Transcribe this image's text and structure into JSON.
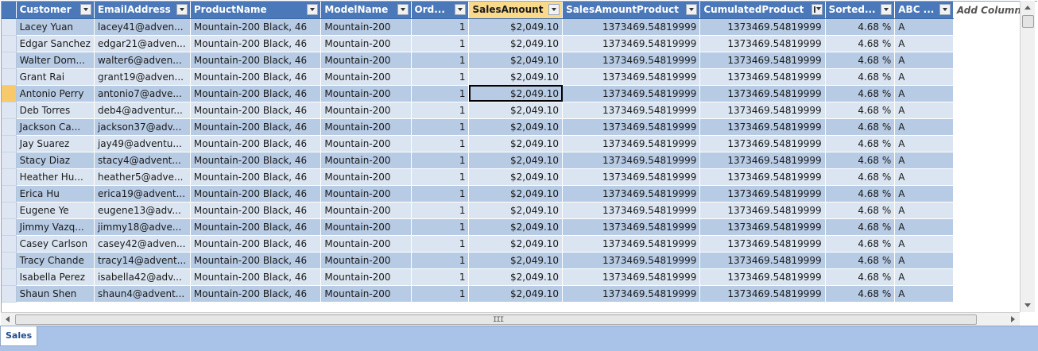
{
  "columns": [
    {
      "label": "Customer",
      "align": "left"
    },
    {
      "label": "EmailAddress",
      "align": "left"
    },
    {
      "label": "ProductName",
      "align": "left"
    },
    {
      "label": "ModelName",
      "align": "left"
    },
    {
      "label": "Ord...",
      "align": "right"
    },
    {
      "label": "SalesAmount",
      "align": "right",
      "selected": true
    },
    {
      "label": "SalesAmountProduct",
      "align": "right"
    },
    {
      "label": "CumulatedProduct",
      "align": "right",
      "filter_applied": true
    },
    {
      "label": "Sorted...",
      "align": "right"
    },
    {
      "label": "ABC ...",
      "align": "left"
    }
  ],
  "add_column_label": "Add Column",
  "rows": [
    [
      "Lacey Yuan",
      "lacey41@adven...",
      "Mountain-200 Black, 46",
      "Mountain-200",
      "1",
      "$2,049.10",
      "1373469.54819999",
      "1373469.54819999",
      "4.68 %",
      "A"
    ],
    [
      "Edgar Sanchez",
      "edgar21@adven...",
      "Mountain-200 Black, 46",
      "Mountain-200",
      "1",
      "$2,049.10",
      "1373469.54819999",
      "1373469.54819999",
      "4.68 %",
      "A"
    ],
    [
      "Walter Dom...",
      "walter6@adven...",
      "Mountain-200 Black, 46",
      "Mountain-200",
      "1",
      "$2,049.10",
      "1373469.54819999",
      "1373469.54819999",
      "4.68 %",
      "A"
    ],
    [
      "Grant Rai",
      "grant19@adven...",
      "Mountain-200 Black, 46",
      "Mountain-200",
      "1",
      "$2,049.10",
      "1373469.54819999",
      "1373469.54819999",
      "4.68 %",
      "A"
    ],
    [
      "Antonio Perry",
      "antonio7@adve...",
      "Mountain-200 Black, 46",
      "Mountain-200",
      "1",
      "$2,049.10",
      "1373469.54819999",
      "1373469.54819999",
      "4.68 %",
      "A"
    ],
    [
      "Deb Torres",
      "deb4@adventur...",
      "Mountain-200 Black, 46",
      "Mountain-200",
      "1",
      "$2,049.10",
      "1373469.54819999",
      "1373469.54819999",
      "4.68 %",
      "A"
    ],
    [
      "Jackson Ca...",
      "jackson37@adv...",
      "Mountain-200 Black, 46",
      "Mountain-200",
      "1",
      "$2,049.10",
      "1373469.54819999",
      "1373469.54819999",
      "4.68 %",
      "A"
    ],
    [
      "Jay Suarez",
      "jay49@adventu...",
      "Mountain-200 Black, 46",
      "Mountain-200",
      "1",
      "$2,049.10",
      "1373469.54819999",
      "1373469.54819999",
      "4.68 %",
      "A"
    ],
    [
      "Stacy Diaz",
      "stacy4@advent...",
      "Mountain-200 Black, 46",
      "Mountain-200",
      "1",
      "$2,049.10",
      "1373469.54819999",
      "1373469.54819999",
      "4.68 %",
      "A"
    ],
    [
      "Heather Hu...",
      "heather5@adve...",
      "Mountain-200 Black, 46",
      "Mountain-200",
      "1",
      "$2,049.10",
      "1373469.54819999",
      "1373469.54819999",
      "4.68 %",
      "A"
    ],
    [
      "Erica Hu",
      "erica19@advent...",
      "Mountain-200 Black, 46",
      "Mountain-200",
      "1",
      "$2,049.10",
      "1373469.54819999",
      "1373469.54819999",
      "4.68 %",
      "A"
    ],
    [
      "Eugene Ye",
      "eugene13@adv...",
      "Mountain-200 Black, 46",
      "Mountain-200",
      "1",
      "$2,049.10",
      "1373469.54819999",
      "1373469.54819999",
      "4.68 %",
      "A"
    ],
    [
      "Jimmy Vazq...",
      "jimmy18@adve...",
      "Mountain-200 Black, 46",
      "Mountain-200",
      "1",
      "$2,049.10",
      "1373469.54819999",
      "1373469.54819999",
      "4.68 %",
      "A"
    ],
    [
      "Casey Carlson",
      "casey42@adven...",
      "Mountain-200 Black, 46",
      "Mountain-200",
      "1",
      "$2,049.10",
      "1373469.54819999",
      "1373469.54819999",
      "4.68 %",
      "A"
    ],
    [
      "Tracy Chande",
      "tracy14@advent...",
      "Mountain-200 Black, 46",
      "Mountain-200",
      "1",
      "$2,049.10",
      "1373469.54819999",
      "1373469.54819999",
      "4.68 %",
      "A"
    ],
    [
      "Isabella Perez",
      "isabella42@adv...",
      "Mountain-200 Black, 46",
      "Mountain-200",
      "1",
      "$2,049.10",
      "1373469.54819999",
      "1373469.54819999",
      "4.68 %",
      "A"
    ],
    [
      "Shaun Shen",
      "shaun4@advent...",
      "Mountain-200 Black, 46",
      "Mountain-200",
      "1",
      "$2,049.10",
      "1373469.54819999",
      "1373469.54819999",
      "4.68 %",
      "A"
    ]
  ],
  "current_row_index": 4,
  "active_cell": {
    "row": 4,
    "column": "SalesAmount"
  },
  "sheet_tabs": [
    {
      "label": "Sales",
      "active": true
    }
  ],
  "scrollbars": {
    "horizontal_grip": "III"
  },
  "colors": {
    "header_bg": "#4a78b8",
    "selected_header_bg": "#f9d98a",
    "row_band_dark": "#b7cbe4",
    "row_band_light": "#dbe5f1",
    "current_row_marker": "#f8c96a",
    "tab_strip_bg": "#a9c2e8"
  }
}
